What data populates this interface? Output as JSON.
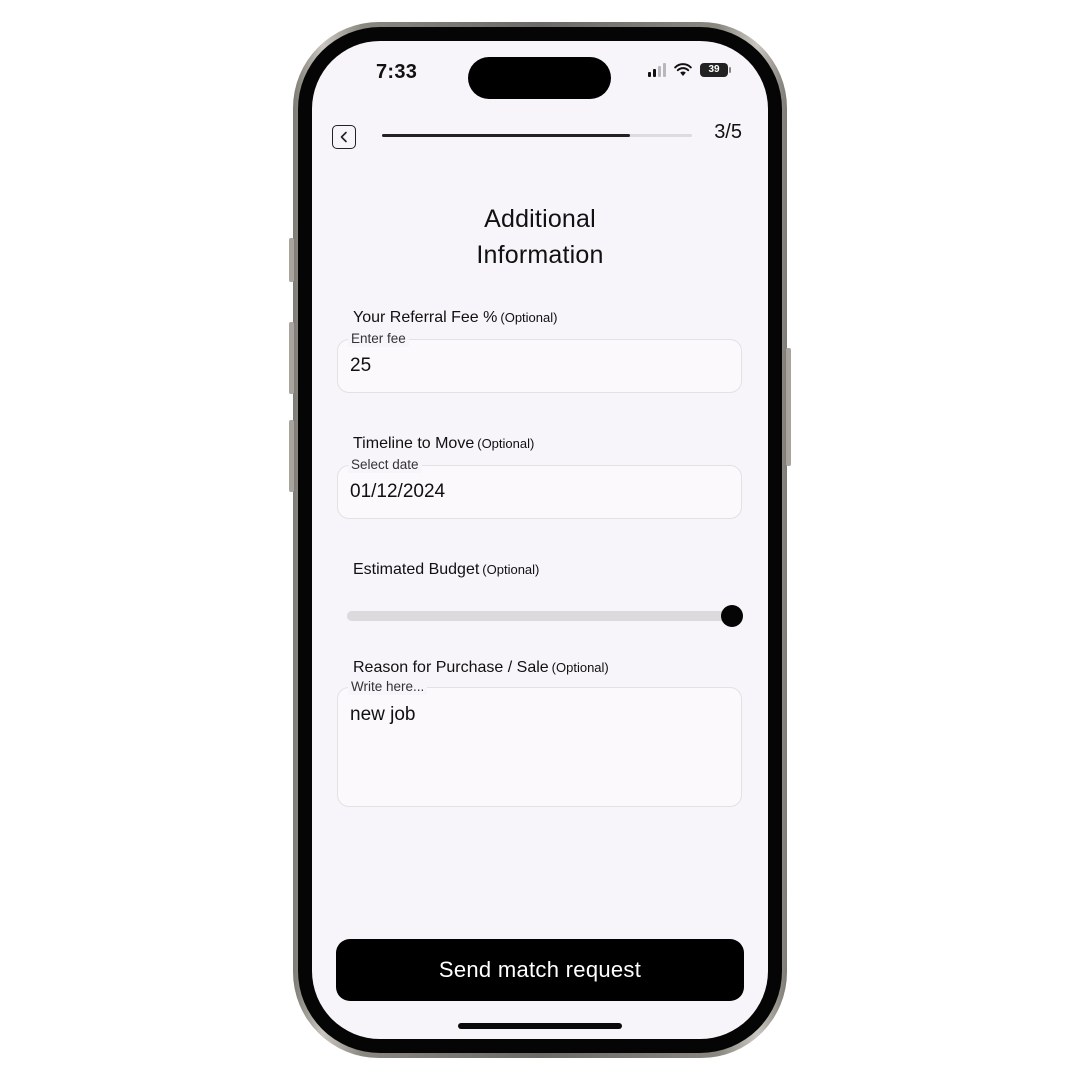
{
  "status_bar": {
    "time": "7:33",
    "battery": "39"
  },
  "header": {
    "step": "3/5",
    "progress": 0.8
  },
  "page": {
    "title_line1": "Additional",
    "title_line2": "Information"
  },
  "form": {
    "fee": {
      "label": "Your Referral Fee %",
      "optional": "(Optional)",
      "caption": "Enter fee",
      "value": "25"
    },
    "timeline": {
      "label": "Timeline to Move",
      "optional": "(Optional)",
      "caption": "Select date",
      "value": "01/12/2024"
    },
    "budget": {
      "label": "Estimated Budget",
      "optional": "(Optional)",
      "slider_value": 1.0
    },
    "reason": {
      "label": "Reason for Purchase / Sale",
      "optional": "(Optional)",
      "caption": "Write here...",
      "value": "new job"
    }
  },
  "actions": {
    "submit_label": "Send match request"
  },
  "colors": {
    "screen_bg": "#f7f4fa",
    "accent": "#000000"
  }
}
